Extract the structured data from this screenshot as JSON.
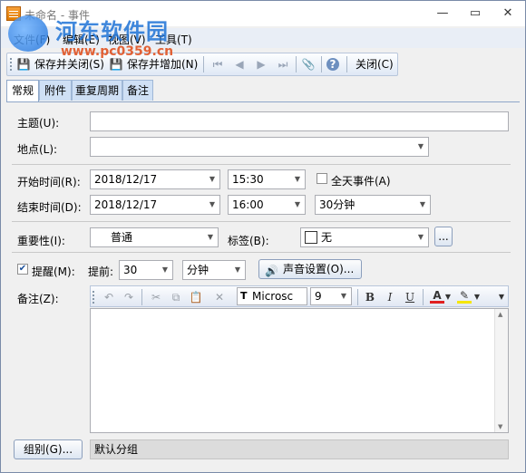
{
  "window": {
    "title": "未命名 - 事件",
    "controls": {
      "minimize": "—",
      "maximize": "▭",
      "close": "✕"
    }
  },
  "watermark": {
    "text": "河东软件园",
    "url": "www.pc0359.cn"
  },
  "menu": {
    "items": [
      "文件(F)",
      "编辑(E)",
      "视图(V)",
      "工具(T)"
    ]
  },
  "toolbar": {
    "save_close": "保存并关闭(S)",
    "save_add": "保存并增加(N)",
    "close": "关闭(C)"
  },
  "tabs": [
    "常规",
    "附件",
    "重复周期",
    "备注"
  ],
  "form": {
    "subject_label": "主题(U):",
    "subject_value": "",
    "location_label": "地点(L):",
    "location_value": "",
    "start_label": "开始时间(R):",
    "start_date": "2018/12/17",
    "start_time": "15:30",
    "allday_label": "全天事件(A)",
    "allday_checked": false,
    "end_label": "结束时间(D):",
    "end_date": "2018/12/17",
    "end_time": "16:00",
    "duration": "30分钟",
    "importance_label": "重要性(I):",
    "importance_value": "普通",
    "tag_label": "标签(B):",
    "tag_value": "无",
    "tag_more": "...",
    "reminder_label": "提醒(M):",
    "reminder_checked": true,
    "advance_label": "提前:",
    "advance_value": "30",
    "advance_unit": "分钟",
    "sound_button": "声音设置(O)...",
    "notes_label": "备注(Z):",
    "font_name": "Microsc",
    "font_size": "9",
    "group_button": "组别(G)...",
    "group_value": "默认分组"
  }
}
